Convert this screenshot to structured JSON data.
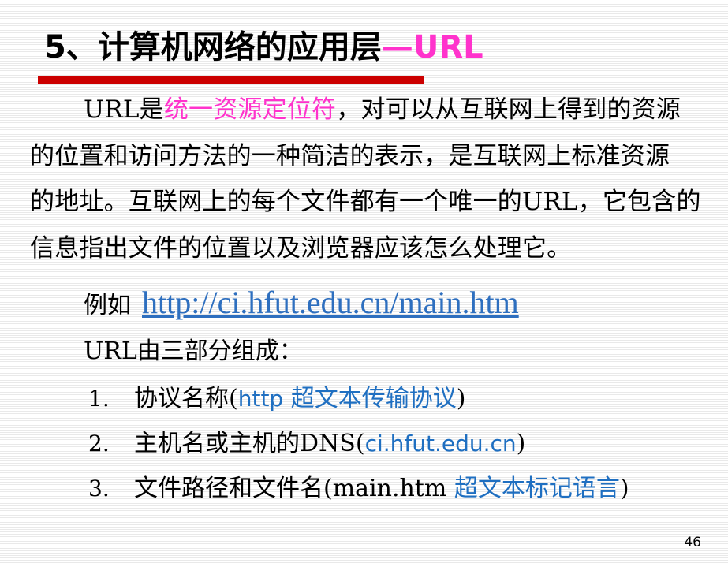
{
  "title": {
    "main": "5、计算机网络的应用层",
    "accent": "—URL"
  },
  "paragraph": {
    "line1_a": "URL是",
    "line1_highlight": "统一资源定位符",
    "line1_b": "，对可以从互联网上得到的资源",
    "line2": "的位置和访问方法的一种简洁的表示，是互联网上标准资源",
    "line3": "的地址。互联网上的每个文件都有一个唯一的URL，它包含的",
    "line4": "信息指出文件的位置以及浏览器应该怎么处理它。"
  },
  "example": {
    "label": "例如",
    "link": "http://ci.hfut.edu.cn/main.htm"
  },
  "intro": "URL由三部分组成：",
  "items": [
    {
      "num": "1.",
      "pre": "协议名称(",
      "highlight": "http 超文本传输协议",
      "post": ")"
    },
    {
      "num": "2.",
      "pre": "主机名或主机的DNS(",
      "highlight": "ci.hfut.edu.cn",
      "post": ")"
    },
    {
      "num": "3.",
      "pre": "文件路径和文件名(main.htm ",
      "highlight": "超文本标记语言",
      "post": ")"
    }
  ],
  "page_number": "46",
  "colors": {
    "accent_pink": "#ff33cc",
    "rule_red": "#cc0000",
    "link_blue": "#2e6fbf",
    "highlight_blue": "#1f6fc1"
  }
}
